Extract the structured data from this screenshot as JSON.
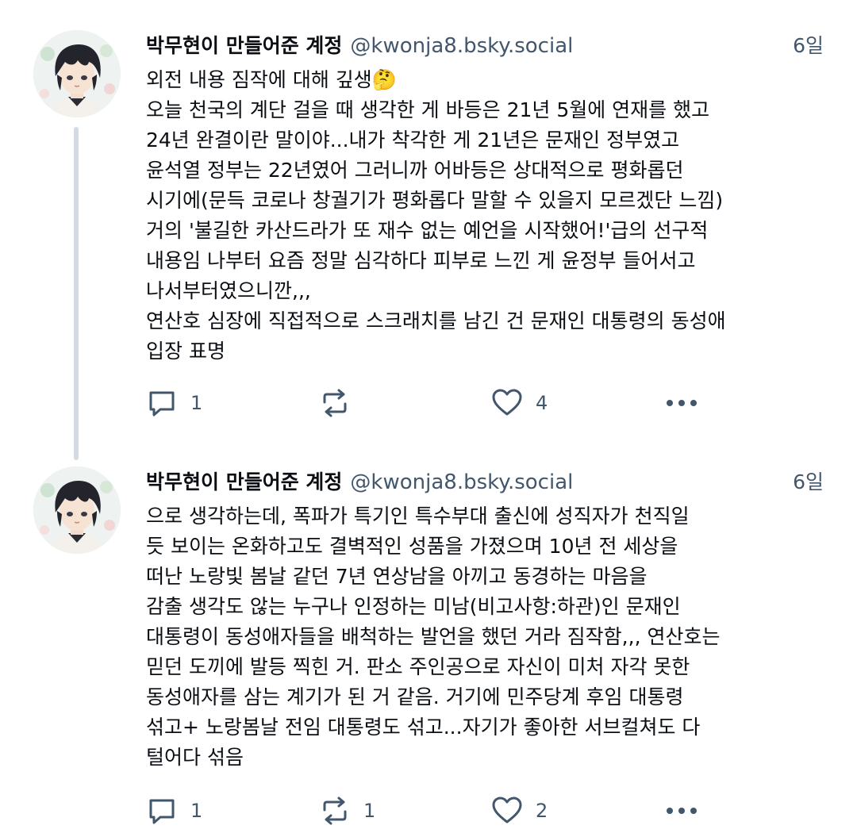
{
  "posts": [
    {
      "author": {
        "display_name": "박무현이 만들어준 계정",
        "handle": "@kwonja8.bsky.social",
        "avatar": "anime-boy-avatar"
      },
      "time": "6일",
      "lines": [
        "외전 내용 짐작에 대해 깊생🤔",
        "오늘 천국의 계단 걸을 때 생각한 게 바등은 21년 5월에 연재를 했고",
        "24년 완결이란 말이야...내가 착각한 게 21년은 문재인 정부였고",
        "윤석열 정부는 22년였어 그러니까 어바등은 상대적으로 평화롭던",
        "시기에(문득 코로나 창궐기가 평화롭다 말할 수 있을지 모르겠단 느낌)",
        "거의 '불길한 카산드라가 또 재수 없는 예언을 시작했어!'급의 선구적",
        "내용임 나부터 요즘 정말 심각하다 피부로 느낀 게 윤정부 들어서고",
        "나서부터였으니깐,,,",
        "연산호 심장에 직접적으로 스크래치를 남긴 건 문재인 대통령의 동성애",
        "입장 표명"
      ],
      "actions": {
        "reply_icon": "speech-bubble-icon",
        "reply_count": "1",
        "repost_icon": "repost-arrows-icon",
        "repost_count": "",
        "like_icon": "heart-outline-icon",
        "like_count": "4",
        "more_icon": "ellipsis-icon"
      }
    },
    {
      "author": {
        "display_name": "박무현이 만들어준 계정",
        "handle": "@kwonja8.bsky.social",
        "avatar": "anime-boy-avatar"
      },
      "time": "6일",
      "lines": [
        "으로 생각하는데, 폭파가 특기인 특수부대 출신에 성직자가 천직일",
        "듯 보이는 온화하고도 결벽적인 성품을 가졌으며 10년 전 세상을",
        "떠난 노랑빛 봄날 같던 7년 연상남을 아끼고 동경하는 마음을",
        "감출 생각도 않는 누구나 인정하는 미남(비고사항:하관)인 문재인",
        "대통령이 동성애자들을 배척하는 발언을 했던 거라 짐작함,,, 연산호는",
        "믿던 도끼에 발등 찍힌 거. 판소 주인공으로 자신이 미처 자각 못한",
        "동성애자를 삼는 계기가 된 거 같음. 거기에 민주당계 후임 대통령",
        "섞고+ 노랑봄날 전임 대통령도 섞고...자기가 좋아한 서브컬쳐도 다",
        "털어다 섞음"
      ],
      "actions": {
        "reply_icon": "speech-bubble-icon",
        "reply_count": "1",
        "repost_icon": "repost-arrows-icon",
        "repost_count": "1",
        "like_icon": "heart-outline-icon",
        "like_count": "2",
        "more_icon": "ellipsis-icon"
      }
    }
  ]
}
